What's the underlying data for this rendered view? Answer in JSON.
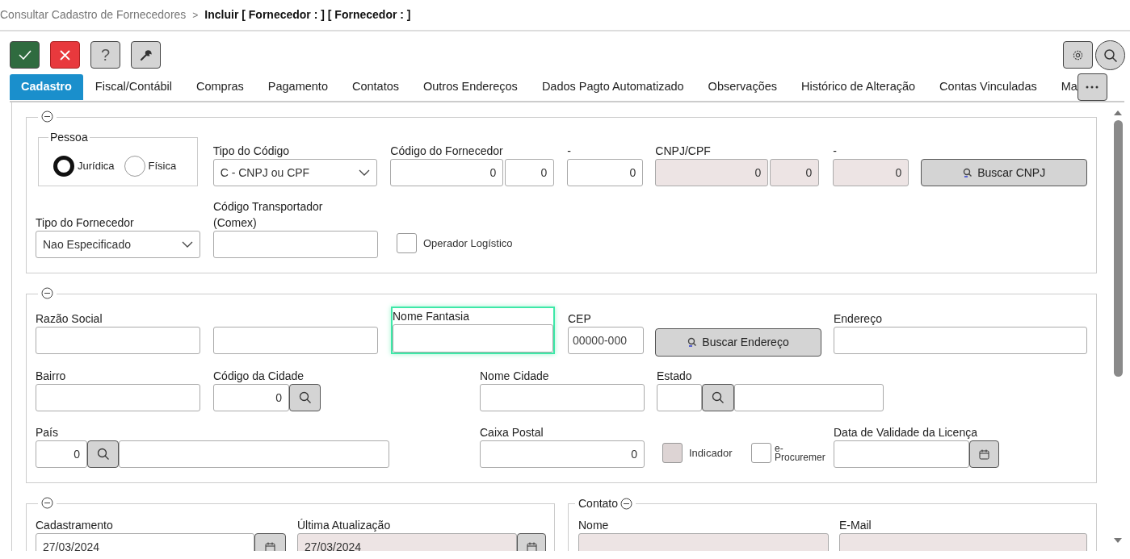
{
  "breadcrumb": {
    "parent": "Consultar Cadastro de Fornecedores",
    "separator": ">",
    "current": "Incluir [ Fornecedor : ] [ Fornecedor : ]"
  },
  "toolbar": {
    "help_label": "?"
  },
  "tabs": [
    {
      "label": "Cadastro",
      "selected": true
    },
    {
      "label": "Fiscal/Contábil",
      "selected": false
    },
    {
      "label": "Compras",
      "selected": false
    },
    {
      "label": "Pagamento",
      "selected": false
    },
    {
      "label": "Contatos",
      "selected": false
    },
    {
      "label": "Outros Endereços",
      "selected": false
    },
    {
      "label": "Dados Pagto Automatizado",
      "selected": false
    },
    {
      "label": "Observações",
      "selected": false
    },
    {
      "label": "Histórico de Alteração",
      "selected": false
    },
    {
      "label": "Contas Vinculadas",
      "selected": false
    },
    {
      "label": "Ma",
      "selected": false
    }
  ],
  "identificacao": {
    "pessoa": {
      "legend": "Pessoa",
      "options": [
        {
          "label": "Jurídica",
          "selected": true
        },
        {
          "label": "Física",
          "selected": false
        }
      ]
    },
    "tipo_codigo": {
      "label": "Tipo do Código",
      "value": "C - CNPJ ou CPF"
    },
    "codigo_fornecedor": {
      "label": "Código do Fornecedor",
      "value": "0",
      "value_2": "0"
    },
    "digito_fornecedor": {
      "label": "-",
      "value": "0"
    },
    "cnpj_cpf": {
      "label": "CNPJ/CPF",
      "value": "0",
      "value_2": "0",
      "disabled": true
    },
    "digito_cnpj": {
      "label": "-",
      "value": "0",
      "disabled": true
    },
    "buscar_cnpj": {
      "label": "Buscar CNPJ"
    },
    "tipo_fornecedor": {
      "label": "Tipo do Fornecedor",
      "value": "Nao Especificado"
    },
    "codigo_transportador": {
      "label": "Código Transportador (Comex)"
    },
    "operador_logistico": {
      "label": "Operador Logístico",
      "checked": false
    }
  },
  "endereco": {
    "razao_social": {
      "label": "Razão Social"
    },
    "nome_fantasia": {
      "label": "Nome Fantasia",
      "focused": true
    },
    "cep": {
      "label": "CEP",
      "placeholder": "00000-000"
    },
    "buscar_endereco": {
      "label": "Buscar Endereço"
    },
    "endereco": {
      "label": "Endereço"
    },
    "bairro": {
      "label": "Bairro"
    },
    "codigo_cidade": {
      "label": "Código da Cidade",
      "value": "0"
    },
    "nome_cidade": {
      "label": "Nome Cidade"
    },
    "estado": {
      "label": "Estado"
    },
    "pais": {
      "label": "País",
      "value": "0"
    },
    "caixa_postal": {
      "label": "Caixa Postal",
      "value": "0"
    },
    "indicador": {
      "label": "Indicador",
      "checked": false,
      "disabled": true
    },
    "e_procurement": {
      "label": "e-Procuremer",
      "checked": false,
      "disabled": false
    },
    "data_validade": {
      "label": "Data de Validade da Licença"
    }
  },
  "datas": {
    "cadastramento": {
      "label": "Cadastramento",
      "value": "27/03/2024",
      "disabled": false
    },
    "ultima_atualizacao": {
      "label": "Última Atualização",
      "value": "27/03/2024",
      "disabled": true
    }
  },
  "contato": {
    "legend": "Contato",
    "nome": {
      "label": "Nome",
      "disabled": true
    },
    "email": {
      "label": "E-Mail",
      "disabled": true
    }
  }
}
